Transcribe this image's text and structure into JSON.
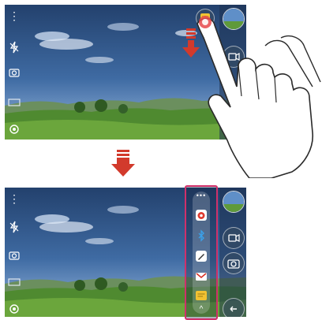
{
  "top_panel": {
    "menu_label": "⋮"
  },
  "bottom_panel": {
    "menu_label": "⋮",
    "float_bar_menu_label": "•••",
    "float_bar_chevron_label": "^"
  },
  "colors": {
    "sky_top": "#2a4a78",
    "sky_mid": "#3f6ba3",
    "sky_low": "#8fb0d6",
    "grass": "#4e8a2c",
    "highlight_frame": "#d0306a",
    "arrow_red": "#d23a2c",
    "memo_yellow": "#f1c232"
  },
  "icons": [
    "menu-icon",
    "flash-off-icon",
    "settings-camera-icon",
    "gallery-icon",
    "settings-icon",
    "quick-memo-icon",
    "video-icon",
    "camera-icon",
    "back-icon",
    "bluetooth-icon",
    "pen-icon",
    "gmail-icon",
    "chevron-up-icon",
    "down-arrow-icon",
    "hand-gesture-icon"
  ]
}
